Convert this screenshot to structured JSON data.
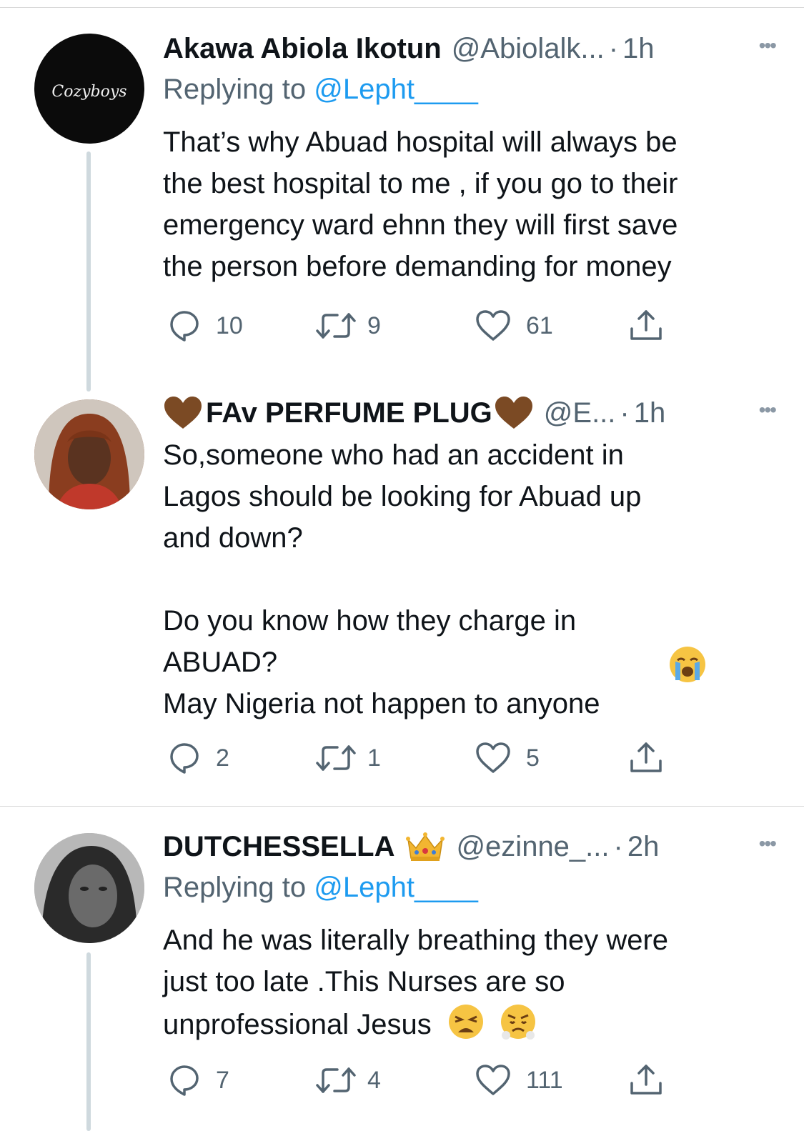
{
  "tweets": [
    {
      "name": "Akawa Abiola Ikotun",
      "handle": "@Abiolalk...",
      "time": "1h",
      "reply_prefix": "Replying to ",
      "reply_mention": "@Lepht____",
      "text": "That’s why Abuad hospital  will always be\nthe best hospital to me , if you go to their\nemergency ward ehnn they will first save\nthe person before demanding for money",
      "avatar_text": "Cozyboys",
      "replies": "10",
      "retweets": "9",
      "likes": "61"
    },
    {
      "name": "FAv PERFUME PLUG",
      "handle": "@E...",
      "time": "1h",
      "text": "So,someone who had an accident in\nLagos should be looking for Abuad up\nand down?\n\nDo you know how they charge in\nABUAD?\nMay Nigeria not happen to anyone",
      "replies": "2",
      "retweets": "1",
      "likes": "5"
    },
    {
      "name": "DUTCHESSELLA",
      "handle": "@ezinne_...",
      "time": "2h",
      "reply_prefix": "Replying to ",
      "reply_mention": "@Lepht____",
      "text_line1": "And he was literally breathing they were",
      "text_line2": "just too late .This Nurses are so",
      "text_line3": "unprofessional Jesus",
      "replies": "7",
      "retweets": "4",
      "likes": "111"
    }
  ],
  "ui": {
    "dot_separator": "·",
    "more_glyph": "•••"
  },
  "colors": {
    "text": "#0f1419",
    "secondary": "#536471",
    "link": "#1d9bf0",
    "divider": "#d9d9d9",
    "thread_line": "#cfd9de"
  }
}
